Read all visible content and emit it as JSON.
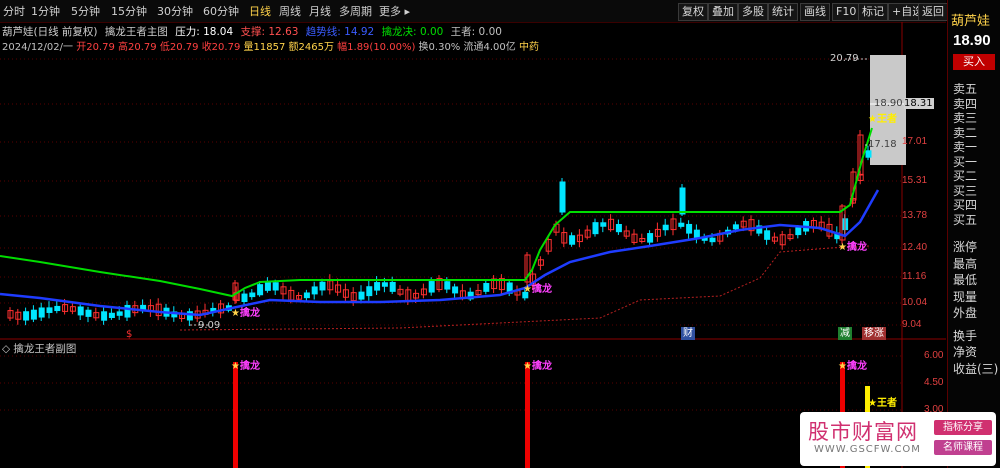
{
  "toolbar": {
    "periods": [
      "分时",
      "1分钟",
      "5分钟",
      "15分钟",
      "30分钟",
      "60分钟",
      "日线",
      "周线",
      "月线",
      "多周期",
      "更多 ▸"
    ],
    "active_period": "日线",
    "tools": [
      "复权",
      "叠加",
      "多股",
      "统计",
      "画线",
      "F10",
      "标记",
      "+自选",
      "返回"
    ]
  },
  "info": {
    "stock_line": "葫芦娃(日线 前复权)",
    "indicator_name": "擒龙王者主图",
    "pressure_label": "压力: 18.04",
    "support_label": "支撑: 12.63",
    "trend_label": "趋势线: 14.92",
    "dragon_label": "擒龙决: 0.00",
    "king_label": "王者: 0.00",
    "date": "2024/12/02/一",
    "open": "开20.79",
    "high": "高20.79",
    "low": "低20.79",
    "close": "收20.79",
    "volume": "量11857",
    "amount": "额2465万",
    "change": "幅1.89(10.00%)",
    "turnover": "换0.30%",
    "float_cap": "流通4.00亿",
    "industry": "中药"
  },
  "sub_title": "擒龙王者副图",
  "right_panel": {
    "name": "葫芦娃",
    "price": "18.90",
    "buy_button": "买入",
    "levels": [
      "卖五",
      "卖四",
      "卖三",
      "卖二",
      "卖一",
      "买一",
      "买二",
      "买三",
      "买四",
      "买五"
    ],
    "labels": [
      "涨停",
      "最高",
      "最低",
      "现量",
      "外盘",
      "换手",
      "净资",
      "收益(三)"
    ]
  },
  "axis_main": [
    "18.31",
    "17.01",
    "15.31",
    "13.78",
    "12.40",
    "11.16",
    "10.04",
    "9.04"
  ],
  "axis_sub": [
    "6.00",
    "4.50",
    "3.00"
  ],
  "annotations": {
    "high_mark": "20.79",
    "low_mark": "9.09",
    "last_price": "18.90",
    "last_line": "18.31",
    "mid_price": "17.18",
    "dragon": "擒龙",
    "king": "★王者"
  },
  "badges": {
    "cai": "财",
    "jian": "减",
    "yizhang": "移涨"
  },
  "colors": {
    "up": "#ff3030",
    "down": "#00e5ff",
    "ma_blue": "#1e3cff",
    "pressure_green": "#00dd00",
    "accent": "#ffd24a"
  },
  "watermark": {
    "title": "股市财富网",
    "url": "WWW.GSCFW.COM",
    "tag1": "指标分享",
    "tag2": "名师课程"
  }
}
